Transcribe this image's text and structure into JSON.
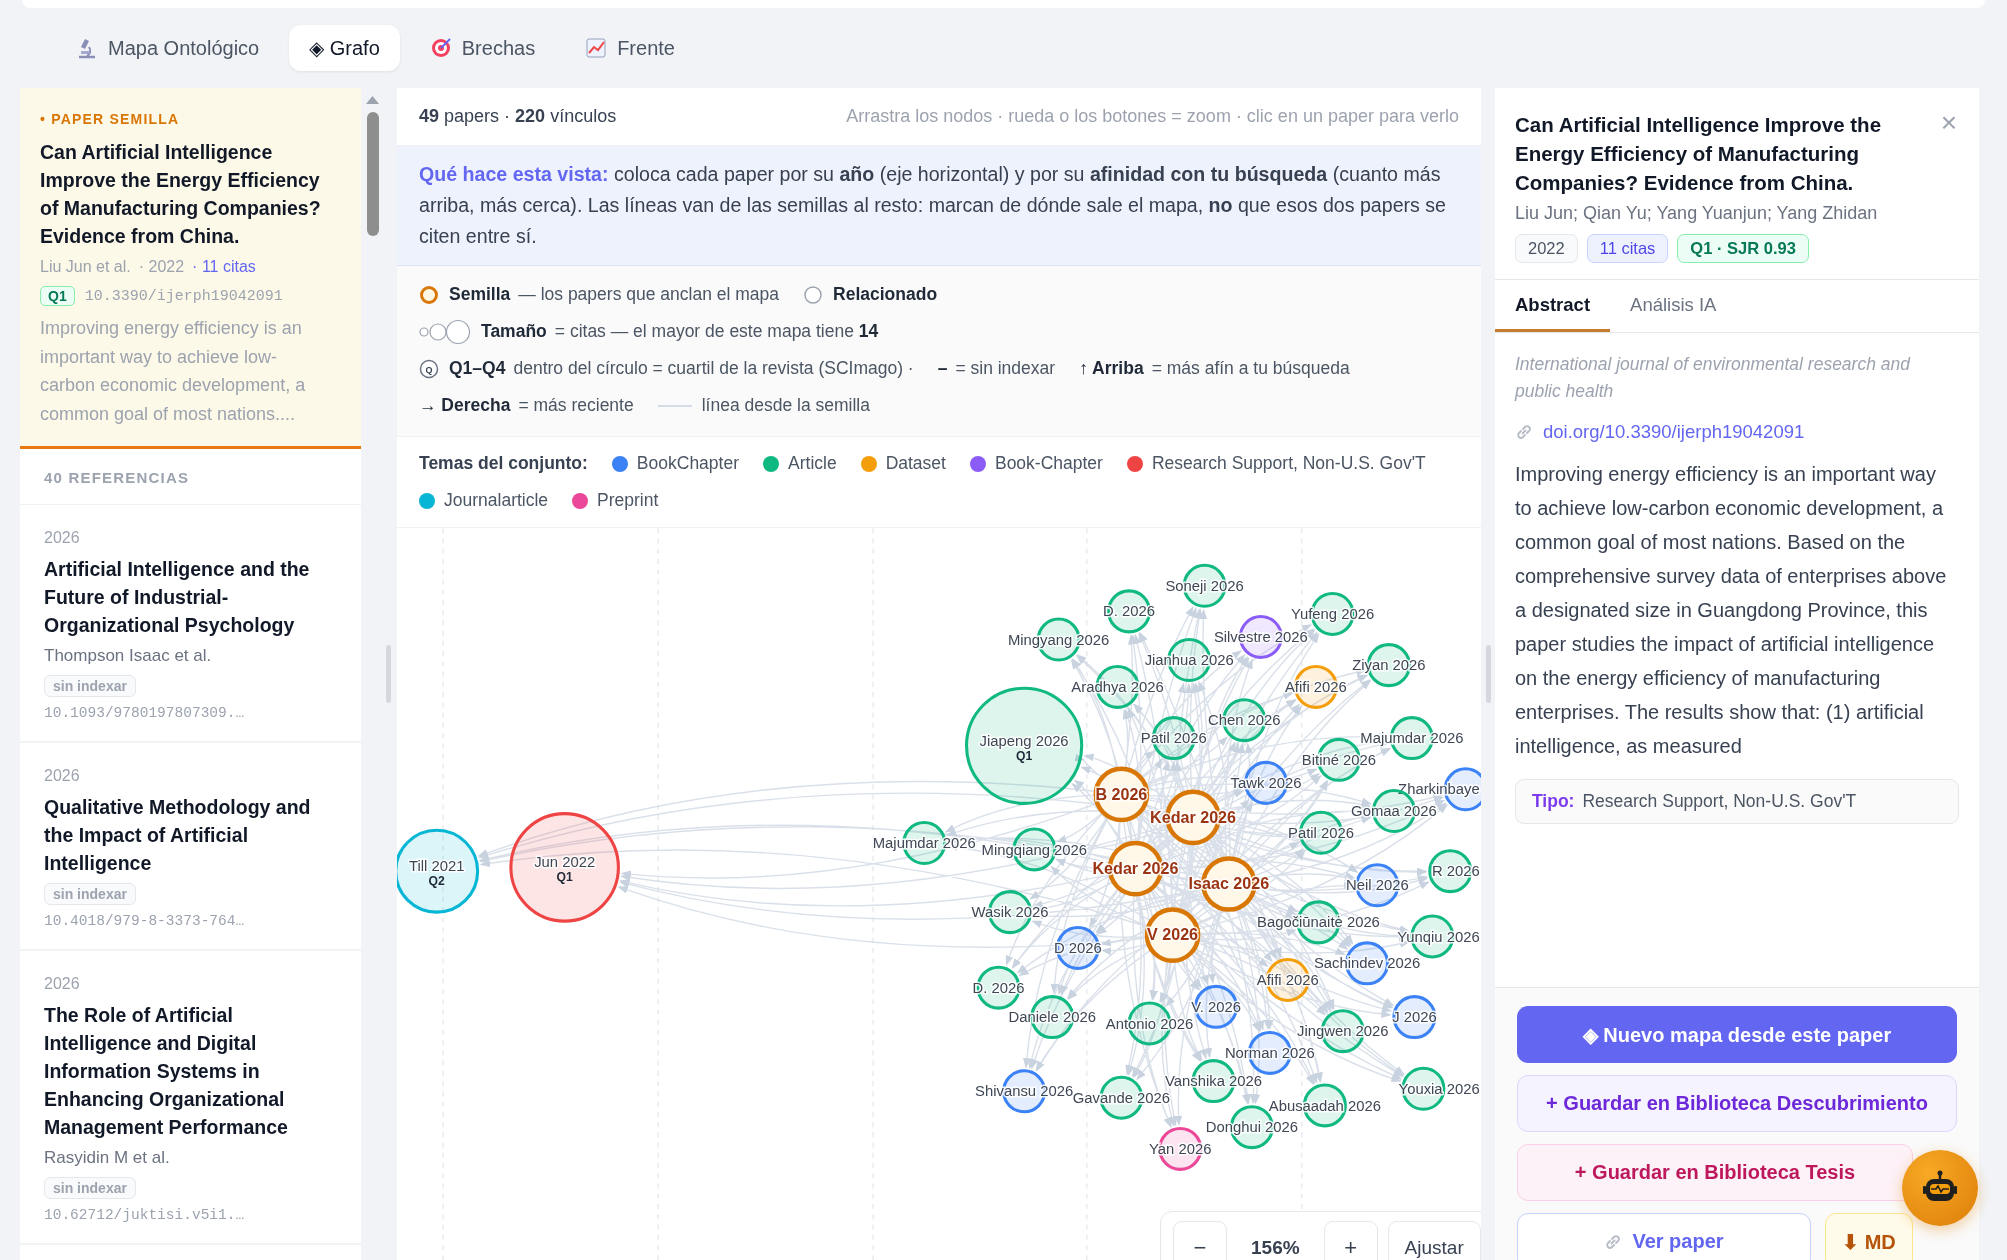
{
  "tabs": [
    {
      "label": "Mapa Ontológico",
      "selected": false
    },
    {
      "label": "◈ Grafo",
      "selected": true
    },
    {
      "label": "Brechas",
      "selected": false
    },
    {
      "label": "Frente",
      "selected": false
    }
  ],
  "seed_paper": {
    "label": "• PAPER SEMILLA",
    "title": "Can Artificial Intelligence Improve the Energy Efficiency of Manufacturing Companies? Evidence from China.",
    "authors": "Liu Jun et al.",
    "year": "· 2022",
    "citations": "· 11 citas",
    "quartile": "Q1",
    "doi": "10.3390/ijerph19042091",
    "abstract": "Improving energy efficiency is an important way to achieve low-carbon economic development, a common goal of most nations...."
  },
  "references": {
    "heading": "40 REFERENCIAS",
    "items": [
      {
        "year": "2026",
        "title": "Artificial Intelligence and the Future of Industrial-Organizational Psychology",
        "authors": "Thompson Isaac et al.",
        "badge": "sin indexar",
        "doi": "10.1093/9780197807309.…"
      },
      {
        "year": "2026",
        "title": "Qualitative Methodology and the Impact of Artificial Intelligence",
        "badge": "sin indexar",
        "doi": "10.4018/979-8-3373-764…"
      },
      {
        "year": "2026",
        "title": "The Role of Artificial Intelligence and Digital Information Systems in Enhancing Organizational Management Performance",
        "authors": "Rasyidin M et al.",
        "badge": "sin indexar",
        "doi": "10.62712/juktisi.v5i1.…"
      }
    ]
  },
  "graph_header": {
    "stats": "**49** papers · **220** vínculos",
    "hint": "Arrastra los nodos · rueda o los botones = zoom · clic en un paper para verlo"
  },
  "info": "**Qué hace esta vista:** coloca cada paper por su **año** (eje horizontal) y por su **afinidad con tu búsqueda** (cuanto más arriba, más cerca). Las líneas van de las semillas al resto: marcan de dónde sale el mapa, **no** que esos dos papers se citen entre sí.",
  "legend": {
    "rows": [
      [
        {
          "kind": "seed",
          "term": "Semilla",
          "text": "— los papers que anclan el mapa"
        },
        {
          "kind": "related",
          "term": "Relacionado"
        }
      ],
      [
        {
          "kind": "size",
          "term": "Tamaño",
          "text": "= citas  — el mayor de este mapa tiene **14**"
        }
      ],
      [
        {
          "kind": "quartile",
          "symbol": "Q",
          "term": "Q1–Q4",
          "text": "dentro del círculo = cuartil de la revista (SCImago) ·"
        },
        {
          "kind": "plain",
          "term": "–",
          "text": "= sin indexar"
        },
        {
          "kind": "plain",
          "term": "↑ Arriba",
          "text": "= más afín a tu búsqueda"
        }
      ],
      [
        {
          "kind": "plain",
          "term": "→ Derecha",
          "text": "= más reciente"
        },
        {
          "kind": "line",
          "text": "línea desde la semilla"
        }
      ]
    ]
  },
  "themes": {
    "label": "Temas del conjunto:",
    "items": [
      {
        "label": "BookChapter",
        "color": "#3b82f6"
      },
      {
        "label": "Article",
        "color": "#10b981"
      },
      {
        "label": "Dataset",
        "color": "#f59e0b"
      },
      {
        "label": "Book-Chapter",
        "color": "#8b5cf6"
      },
      {
        "label": "Research Support, Non-U.S. Gov'T",
        "color": "#ef4444"
      },
      {
        "label": "Journalarticle",
        "color": "#06b6d4"
      },
      {
        "label": "Preprint",
        "color": "#ec4899"
      }
    ]
  },
  "graph": {
    "nodes": [
      {
        "label": "Soneji 2026",
        "kind": "related",
        "color": "#10b981"
      },
      {
        "label": "D. 2026",
        "kind": "related",
        "color": "#10b981"
      },
      {
        "label": "Yufeng 2026",
        "kind": "related",
        "color": "#10b981"
      },
      {
        "label": "Mingyang 2026",
        "kind": "related",
        "color": "#10b981"
      },
      {
        "label": "Silvestre 2026",
        "kind": "related",
        "color": "#8b5cf6"
      },
      {
        "label": "Jianhua 2026",
        "kind": "related",
        "color": "#10b981"
      },
      {
        "label": "Ziyan 2026",
        "kind": "related",
        "color": "#10b981"
      },
      {
        "label": "Aradhya 2026",
        "kind": "related",
        "color": "#10b981"
      },
      {
        "label": "Afifi 2026",
        "kind": "related",
        "color": "#f59e0b"
      },
      {
        "label": "Jiapeng 2026",
        "quartile": "Q1",
        "kind": "related",
        "color": "#10b981"
      },
      {
        "label": "Patil 2026",
        "kind": "related",
        "color": "#10b981"
      },
      {
        "label": "Chen 2026",
        "kind": "related",
        "color": "#10b981"
      },
      {
        "label": "Majumdar 2026",
        "kind": "related",
        "color": "#10b981"
      },
      {
        "label": "Bitiné 2026",
        "kind": "related",
        "color": "#10b981"
      },
      {
        "label": "B 2026",
        "kind": "seed"
      },
      {
        "label": "Tawk 2026",
        "kind": "related",
        "color": "#3b82f6"
      },
      {
        "label": "Zharkinbaye",
        "kind": "related",
        "color": "#3b82f6"
      },
      {
        "label": "Kedar 2026",
        "kind": "seed"
      },
      {
        "label": "Gomaa 2026",
        "kind": "related",
        "color": "#10b981"
      },
      {
        "label": "Till 2021",
        "quartile": "Q2",
        "kind": "related",
        "color": "#06b6d4"
      },
      {
        "label": "Jun 2022",
        "quartile": "Q1",
        "kind": "related",
        "color": "#ef4444"
      },
      {
        "label": "Majumdar 2026",
        "kind": "related",
        "color": "#10b981"
      },
      {
        "label": "Mingqiang 2026",
        "kind": "related",
        "color": "#10b981"
      },
      {
        "label": "Patil 2026",
        "kind": "related",
        "color": "#10b981"
      },
      {
        "label": "Kedar 2026",
        "kind": "seed"
      },
      {
        "label": "Isaac 2026",
        "kind": "seed"
      },
      {
        "label": "Neil 2026",
        "kind": "related",
        "color": "#3b82f6"
      },
      {
        "label": "R 2026",
        "kind": "related",
        "color": "#10b981"
      },
      {
        "label": "Wasik 2026",
        "kind": "related",
        "color": "#10b981"
      },
      {
        "label": "Bagočiūnaitė 2026",
        "kind": "related",
        "color": "#10b981"
      },
      {
        "label": "D 2026",
        "kind": "related",
        "color": "#3b82f6"
      },
      {
        "label": "V 2026",
        "kind": "seed"
      },
      {
        "label": "Yunqiu 2026",
        "kind": "related",
        "color": "#10b981"
      },
      {
        "label": "Sachindev 2026",
        "kind": "related",
        "color": "#3b82f6"
      },
      {
        "label": "D. 2026",
        "kind": "related",
        "color": "#10b981"
      },
      {
        "label": "Afifi 2026",
        "kind": "related",
        "color": "#f59e0b"
      },
      {
        "label": "Daniele 2026",
        "kind": "related",
        "color": "#10b981"
      },
      {
        "label": "Antonio 2026",
        "kind": "related",
        "color": "#10b981"
      },
      {
        "label": "V. 2026",
        "kind": "related",
        "color": "#3b82f6"
      },
      {
        "label": "Jingwen 2026",
        "kind": "related",
        "color": "#10b981"
      },
      {
        "label": "J 2026",
        "kind": "related",
        "color": "#3b82f6"
      },
      {
        "label": "Norman 2026",
        "kind": "related",
        "color": "#3b82f6"
      },
      {
        "label": "Shivansu 2026",
        "kind": "related",
        "color": "#3b82f6"
      },
      {
        "label": "Gavande 2026",
        "kind": "related",
        "color": "#10b981"
      },
      {
        "label": "Vanshika 2026",
        "kind": "related",
        "color": "#10b981"
      },
      {
        "label": "Abusaadah 2026",
        "kind": "related",
        "color": "#10b981"
      },
      {
        "label": "Youxia 2026",
        "kind": "related",
        "color": "#10b981"
      },
      {
        "label": "Donghui 2026",
        "kind": "related",
        "color": "#10b981"
      },
      {
        "label": "Yan 2026",
        "kind": "related",
        "color": "#ec4899"
      }
    ],
    "zoom": {
      "zoom_out": "−",
      "level_text": "156%",
      "zoom_in": "+",
      "fit": "Ajustar"
    }
  },
  "detail": {
    "close": "×",
    "title": "Can Artificial Intelligence Improve the Energy Efficiency of Manufacturing Companies? Evidence from China.",
    "authors": "Liu Jun; Qian Yu; Yang Yuanjun; Yang Zhidan",
    "badges": [
      {
        "kind": "year",
        "label": "2022"
      },
      {
        "kind": "citations",
        "label": "11 citas"
      },
      {
        "kind": "quartile",
        "label": "Q1 · SJR 0.93"
      }
    ],
    "tabs": [
      {
        "label": "Abstract",
        "selected": true
      },
      {
        "label": "Análisis IA",
        "selected": false
      }
    ],
    "journal": "International journal of environmental research and public health",
    "doi_link": "doi.org/10.3390/ijerph19042091",
    "abstract": "Improving energy efficiency is an important way to achieve low-carbon economic development, a common goal of most nations. Based on the comprehensive survey data of enterprises above a designated size in Guangdong Province, this paper studies the impact of artificial intelligence on the energy efficiency of manufacturing enterprises. The results show that: (1) artificial intelligence, as measured",
    "type": {
      "label": "Tipo:",
      "value": "Research Support, Non-U.S. Gov'T"
    },
    "actions": [
      {
        "kind": "primary",
        "label": "◈ Nuevo mapa desde este paper"
      },
      {
        "kind": "library",
        "label": "+ Guardar en Biblioteca Descubrimiento"
      },
      {
        "kind": "thesis",
        "label": "+ Guardar en Biblioteca Tesis"
      }
    ],
    "bottom_actions": [
      {
        "kind": "link",
        "label": "Ver paper"
      },
      {
        "kind": "download",
        "label": "⬇ MD"
      }
    ]
  }
}
